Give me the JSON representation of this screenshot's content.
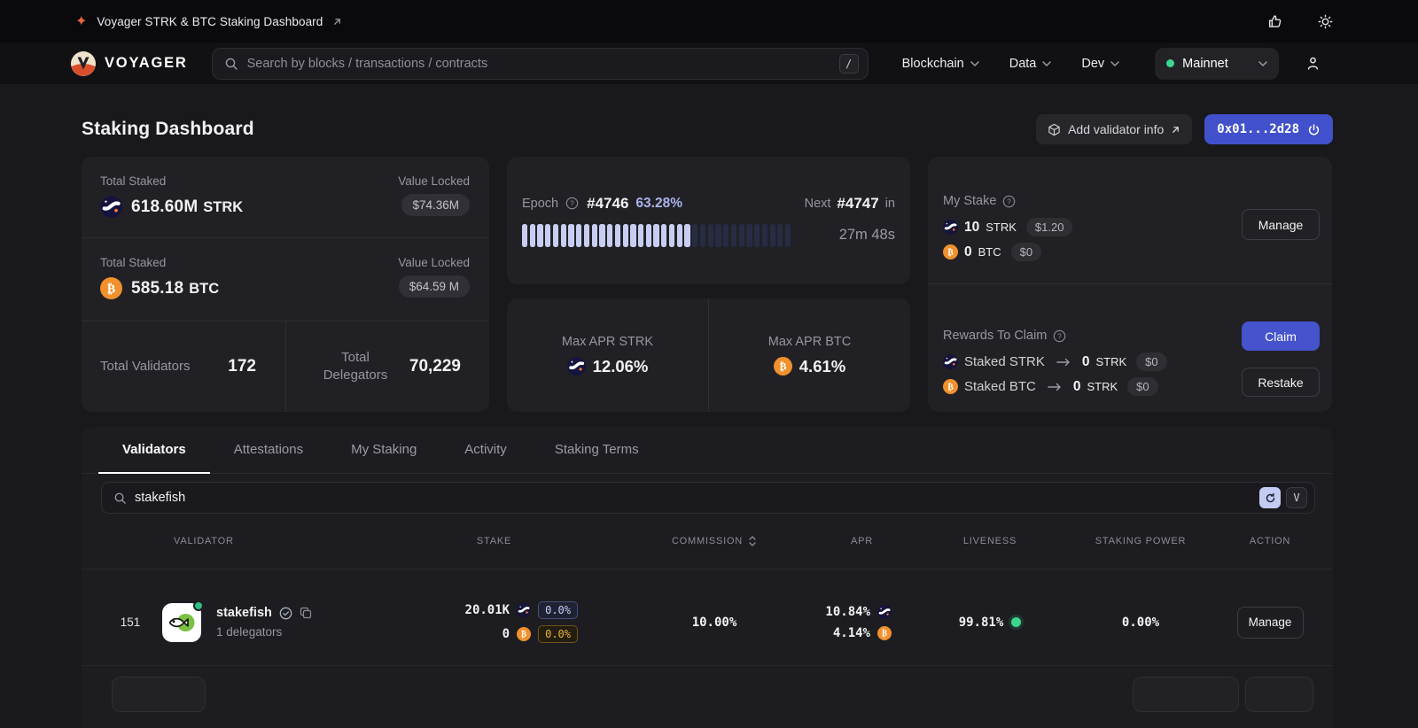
{
  "announcement": {
    "title": "Voyager STRK & BTC Staking Dashboard"
  },
  "header": {
    "brand": "VOYAGER",
    "search_placeholder": "Search by blocks / transactions / contracts",
    "search_shortcut": "/",
    "nav": [
      {
        "label": "Blockchain"
      },
      {
        "label": "Data"
      },
      {
        "label": "Dev"
      }
    ],
    "network": "Mainnet"
  },
  "page": {
    "title": "Staking Dashboard",
    "add_validator": "Add validator info",
    "wallet": "0x01...2d28"
  },
  "stats": {
    "strk": {
      "label": "Total Staked",
      "amount": "618.60M",
      "unit": "STRK",
      "locked_label": "Value Locked",
      "locked": "$74.36M"
    },
    "btc": {
      "label": "Total Staked",
      "amount": "585.18",
      "unit": "BTC",
      "locked_label": "Value Locked",
      "locked": "$64.59 M"
    },
    "validators": {
      "label": "Total Validators",
      "value": "172"
    },
    "delegators": {
      "label": "Total Delegators",
      "value": "70,229"
    }
  },
  "epoch": {
    "label": "Epoch",
    "current": "#4746",
    "progress_pct": "63.28%",
    "next_label": "Next",
    "next": "#4747",
    "in_label": "in",
    "remaining": "27m 48s",
    "segments_total": 35,
    "segments_filled": 22
  },
  "apr": {
    "strk_label": "Max APR STRK",
    "strk": "12.06%",
    "btc_label": "Max APR BTC",
    "btc": "4.61%"
  },
  "my_stake": {
    "label": "My Stake",
    "strk": {
      "amount": "10",
      "unit": "STRK",
      "usd": "$1.20"
    },
    "btc": {
      "amount": "0",
      "unit": "BTC",
      "usd": "$0"
    },
    "manage": "Manage"
  },
  "rewards": {
    "label": "Rewards To Claim",
    "strk": {
      "name": "Staked STRK",
      "amount": "0",
      "unit": "STRK",
      "usd": "$0"
    },
    "btc": {
      "name": "Staked BTC",
      "amount": "0",
      "unit": "STRK",
      "usd": "$0"
    },
    "claim": "Claim",
    "restake": "Restake"
  },
  "tabs": [
    {
      "label": "Validators"
    },
    {
      "label": "Attestations"
    },
    {
      "label": "My Staking"
    },
    {
      "label": "Activity"
    },
    {
      "label": "Staking Terms"
    }
  ],
  "table_search": {
    "value": "stakefish",
    "shortcut": "V"
  },
  "table": {
    "columns": [
      "VALIDATOR",
      "STAKE",
      "COMMISSION",
      "APR",
      "LIVENESS",
      "STAKING POWER",
      "ACTION"
    ],
    "row": {
      "rank": "151",
      "name": "stakefish",
      "delegators": "1 delegators",
      "stake_strk": "20.01K",
      "stake_strk_pct": "0.0%",
      "stake_btc": "0",
      "stake_btc_pct": "0.0%",
      "commission": "10.00%",
      "apr_strk": "10.84%",
      "apr_btc": "4.14%",
      "liveness": "99.81%",
      "staking_power": "0.00%",
      "action": "Manage"
    }
  }
}
